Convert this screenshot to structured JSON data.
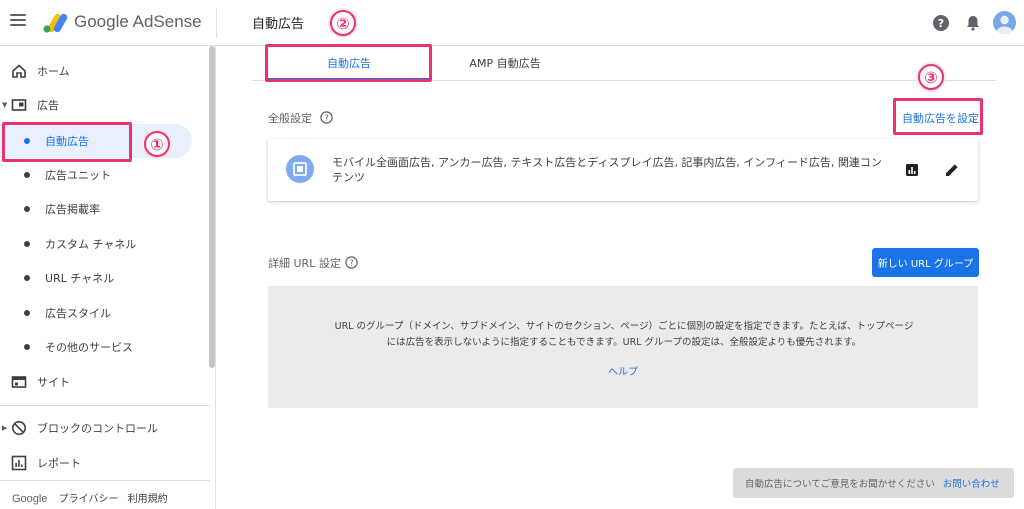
{
  "header": {
    "brand": "Google AdSense",
    "page_title": "自動広告"
  },
  "sidebar": {
    "items": [
      {
        "label": "ホーム"
      },
      {
        "label": "広告"
      },
      {
        "label": "自動広告"
      },
      {
        "label": "広告ユニット"
      },
      {
        "label": "広告掲載率"
      },
      {
        "label": "カスタム チャネル"
      },
      {
        "label": "URL チャネル"
      },
      {
        "label": "広告スタイル"
      },
      {
        "label": "その他のサービス"
      },
      {
        "label": "サイト"
      },
      {
        "label": "ブロックのコントロール"
      },
      {
        "label": "レポート"
      }
    ],
    "footer": {
      "brand": "Google",
      "privacy": "プライバシー",
      "terms": "利用規約"
    }
  },
  "tabs": [
    {
      "label": "自動広告"
    },
    {
      "label": "AMP 自動広告"
    }
  ],
  "general": {
    "label": "全般設定",
    "action": "自動広告を設定",
    "summary": "モバイル全画面広告, アンカー広告, テキスト広告とディスプレイ広告, 記事内広告, インフィード広告, 関連コンテンツ"
  },
  "url_settings": {
    "label": "詳細 URL 設定",
    "button": "新しい URL グループ",
    "description": "URL のグループ（ドメイン、サブドメイン、サイトのセクション、ページ）ごとに個別の設定を指定できます。たとえば、トップページには広告を表示しないように指定することもできます。URL グループの設定は、全般設定よりも優先されます。",
    "help": "ヘルプ"
  },
  "feedback": {
    "message": "自動広告についてご意見をお聞かせください",
    "contact": "お問い合わせ"
  },
  "annotations": [
    "①",
    "②",
    "③"
  ],
  "colors": {
    "accent": "#1a73e8",
    "highlight": "#e8336e"
  }
}
